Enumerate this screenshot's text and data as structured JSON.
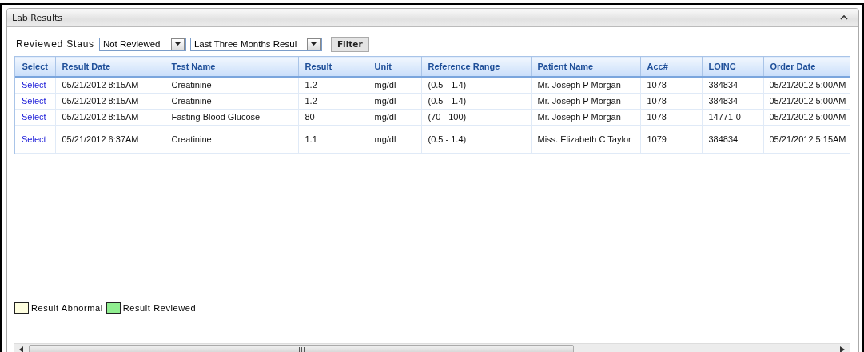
{
  "panel": {
    "title": "Lab Results",
    "expanded": true
  },
  "filters": {
    "label": "Reviewed Staus",
    "status_select": "Not Reviewed",
    "period_select": "Last Three Months Resul",
    "button": "Filter"
  },
  "table": {
    "columns": [
      "Select",
      "Result Date",
      "Test Name",
      "Result",
      "Unit",
      "Reference Range",
      "Patient Name",
      "Acc#",
      "LOINC",
      "Order Date"
    ],
    "rows": [
      {
        "cells": [
          "Select",
          "05/21/2012 8:15AM",
          "Creatinine",
          "1.2",
          "mg/dl",
          "(0.5 - 1.4)",
          "Mr. Joseph P Morgan",
          "1078",
          "384834",
          "05/21/2012 5:00AM"
        ]
      },
      {
        "cells": [
          "Select",
          "05/21/2012 8:15AM",
          "Creatinine",
          "1.2",
          "mg/dl",
          "(0.5 - 1.4)",
          "Mr. Joseph P Morgan",
          "1078",
          "384834",
          "05/21/2012 5:00AM"
        ]
      },
      {
        "cells": [
          "Select",
          "05/21/2012 8:15AM",
          "Fasting Blood Glucose",
          "80",
          "mg/dl",
          "(70 - 100)",
          "Mr. Joseph P Morgan",
          "1078",
          "14771-0",
          "05/21/2012 5:00AM"
        ]
      },
      {
        "cells": [
          "Select",
          "05/21/2012 6:37AM",
          "Creatinine",
          "1.1",
          "mg/dl",
          "(0.5 - 1.4)",
          "Miss. Elizabeth C Taylor",
          "1079",
          "384834",
          "05/21/2012 5:15AM"
        ]
      }
    ]
  },
  "legend": [
    {
      "label": "Result Abnormal",
      "color": "#ffffe0"
    },
    {
      "label": "Result Reviewed",
      "color": "#90ee90"
    }
  ]
}
